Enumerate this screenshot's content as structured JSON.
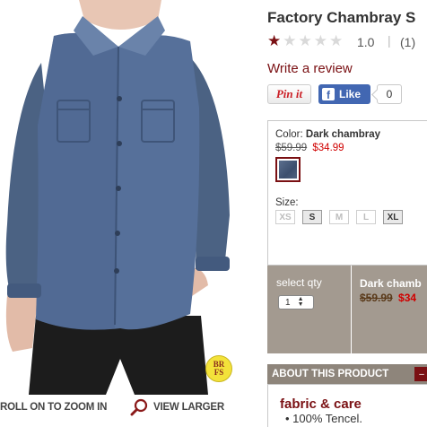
{
  "product": {
    "title": "Factory Chambray S",
    "brand_badge_top": "BR",
    "brand_badge_bottom": "FS",
    "zoom_hint": "ROLL ON TO ZOOM IN",
    "view_larger": "VIEW LARGER"
  },
  "rating": {
    "stars_filled": 1,
    "stars_total": 5,
    "value": "1.0",
    "separator": "|",
    "count": "(1)",
    "star_color": "#7a1013"
  },
  "review": {
    "write_label": "Write a review"
  },
  "social": {
    "pinit_label": "Pin it",
    "fb_icon": "f",
    "fb_like_label": "Like",
    "fb_count": "0"
  },
  "options": {
    "color_label": "Color:",
    "color_value": "Dark chambray",
    "old_price": "$59.99",
    "sale_price": "$34.99",
    "size_label": "Size:",
    "sizes": [
      {
        "label": "XS",
        "available": false
      },
      {
        "label": "S",
        "available": true
      },
      {
        "label": "M",
        "available": false
      },
      {
        "label": "L",
        "available": false
      },
      {
        "label": "XL",
        "available": true
      }
    ]
  },
  "purchase": {
    "qty_label": "select qty",
    "qty_value": "1",
    "summary_name": "Dark chamb",
    "summary_old_price": "$59.99",
    "summary_sale_price": "$34"
  },
  "about": {
    "title": "ABOUT THIS PRODUCT",
    "fabric_title": "fabric & care",
    "fabric_items": [
      "100% Tencel."
    ]
  },
  "colors": {
    "brand_red": "#7a1013",
    "sale_red": "#d00000",
    "panel_taupe": "#a39a90",
    "facebook_blue": "#4267b2"
  }
}
